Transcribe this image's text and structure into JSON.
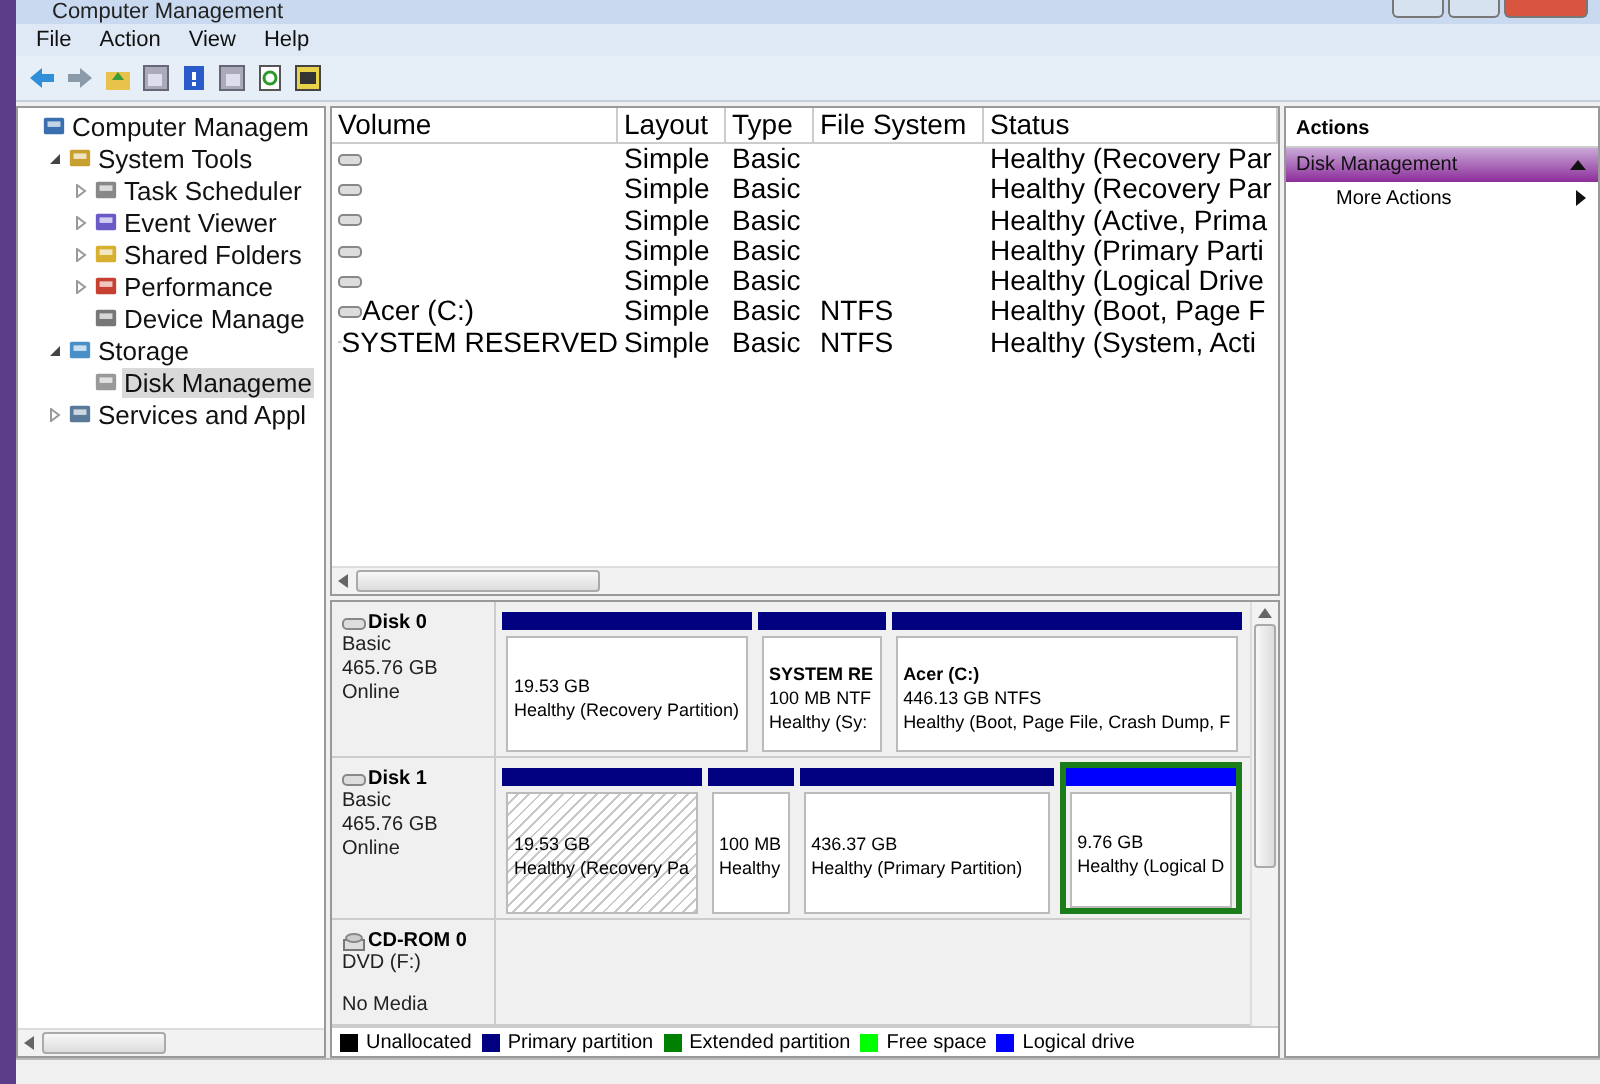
{
  "window": {
    "title": "Computer Management"
  },
  "menu": [
    "File",
    "Action",
    "View",
    "Help"
  ],
  "tree": [
    {
      "label": "Computer Managem",
      "kind": "computer",
      "selected": false,
      "children": [
        {
          "label": "System Tools",
          "kind": "tools",
          "expanded": true,
          "selected": false,
          "children": [
            {
              "label": "Task Scheduler",
              "kind": "clock",
              "expanded": false,
              "selected": false
            },
            {
              "label": "Event Viewer",
              "kind": "event",
              "expanded": false,
              "selected": false
            },
            {
              "label": "Shared Folders",
              "kind": "folder",
              "expanded": false,
              "selected": false
            },
            {
              "label": "Performance",
              "kind": "gauge",
              "expanded": false,
              "selected": false
            },
            {
              "label": "Device Manage",
              "kind": "device",
              "selected": false
            }
          ]
        },
        {
          "label": "Storage",
          "kind": "storage",
          "expanded": true,
          "selected": false,
          "children": [
            {
              "label": "Disk Manageme",
              "kind": "disk",
              "selected": true
            }
          ]
        },
        {
          "label": "Services and Appl",
          "kind": "services",
          "expanded": false,
          "selected": false
        }
      ]
    }
  ],
  "volume_table": {
    "columns": [
      "Volume",
      "Layout",
      "Type",
      "File System",
      "Status"
    ],
    "rows": [
      {
        "layout": "Simple",
        "type": "Basic",
        "status": "Healthy (Recovery Par"
      },
      {
        "layout": "Simple",
        "type": "Basic",
        "status": "Healthy (Recovery Par"
      },
      {
        "layout": "Simple",
        "type": "Basic",
        "status": "Healthy (Active, Prima"
      },
      {
        "layout": "Simple",
        "type": "Basic",
        "status": "Healthy (Primary Parti"
      },
      {
        "layout": "Simple",
        "type": "Basic",
        "status": "Healthy (Logical Drive"
      },
      {
        "volume": "Acer (C:)",
        "layout": "Simple",
        "type": "Basic",
        "file_system": "NTFS",
        "status": "Healthy (Boot, Page F"
      },
      {
        "volume": "SYSTEM RESERVED",
        "layout": "Simple",
        "type": "Basic",
        "file_system": "NTFS",
        "status": "Healthy (System, Acti"
      }
    ]
  },
  "disks": [
    {
      "name": "Disk 0",
      "kind": "disk",
      "lines": [
        "Basic",
        "465.76 GB",
        "Online"
      ],
      "partitions": [
        {
          "size": "19.53 GB",
          "status": "Healthy (Recovery Partition)",
          "kind": "primary",
          "selected": false
        },
        {
          "label": "SYSTEM RE",
          "size": "100 MB NTF",
          "status": "Healthy (Sy:",
          "kind": "primary",
          "selected": false
        },
        {
          "label": "Acer  (C:)",
          "size": "446.13 GB NTFS",
          "status": "Healthy (Boot, Page File, Crash Dump, F",
          "kind": "primary",
          "selected": false
        }
      ]
    },
    {
      "name": "Disk 1",
      "kind": "disk",
      "lines": [
        "Basic",
        "465.76 GB",
        "Online"
      ],
      "partitions": [
        {
          "size": "19.53 GB",
          "status": "Healthy (Recovery Pa",
          "kind": "primary",
          "selected": true
        },
        {
          "size": "100 MB",
          "status": "Healthy",
          "kind": "primary",
          "selected": false
        },
        {
          "size": "436.37 GB",
          "status": "Healthy (Primary Partition)",
          "kind": "primary",
          "selected": false
        },
        {
          "size": "9.76 GB",
          "status": "Healthy (Logical D",
          "kind": "logical",
          "selected": false
        }
      ]
    },
    {
      "name": "CD-ROM 0",
      "kind": "cdrom",
      "lines": [
        "DVD (F:)",
        "No Media"
      ]
    }
  ],
  "legend": [
    {
      "label": "Unallocated",
      "color": "#000000"
    },
    {
      "label": "Primary partition",
      "color": "#000080"
    },
    {
      "label": "Extended partition",
      "color": "#008000"
    },
    {
      "label": "Free space",
      "color": "#00ff00"
    },
    {
      "label": "Logical drive",
      "color": "#0000ff"
    }
  ],
  "actions": {
    "title": "Actions",
    "section": "Disk Management",
    "items": [
      "More Actions"
    ]
  }
}
